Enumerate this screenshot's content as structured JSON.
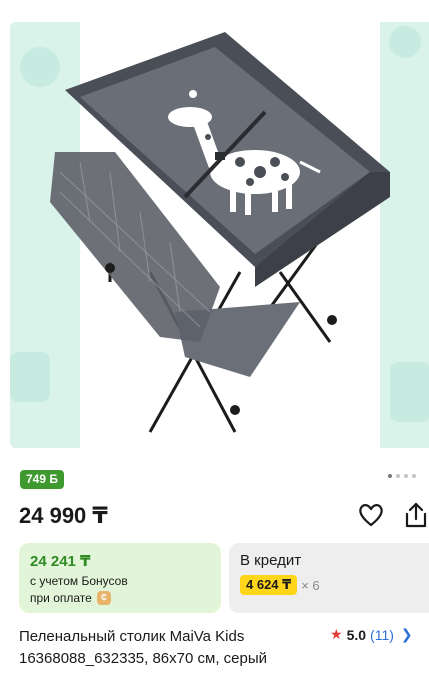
{
  "product": {
    "bonus_badge": "749 Б",
    "price": "24 990 ₸",
    "title": "Пеленальный столик MaiVa Kids 16368088_632335, 86x70 см, серый"
  },
  "bonus_offer": {
    "price": "24 241 ₸",
    "line1": "с учетом Бонусов",
    "line2": "при оплате"
  },
  "credit_offer": {
    "title": "В кредит",
    "monthly": "4 624 ₸",
    "times": "× 6"
  },
  "rating": {
    "score": "5.0",
    "count": "(11)"
  },
  "gallery": {
    "dots_total": 4,
    "dots_active": 1
  },
  "colors": {
    "accent_green": "#3e9a2f",
    "credit_yellow": "#ffd51a",
    "link_blue": "#2e6fd6",
    "star_red": "#e53935"
  }
}
